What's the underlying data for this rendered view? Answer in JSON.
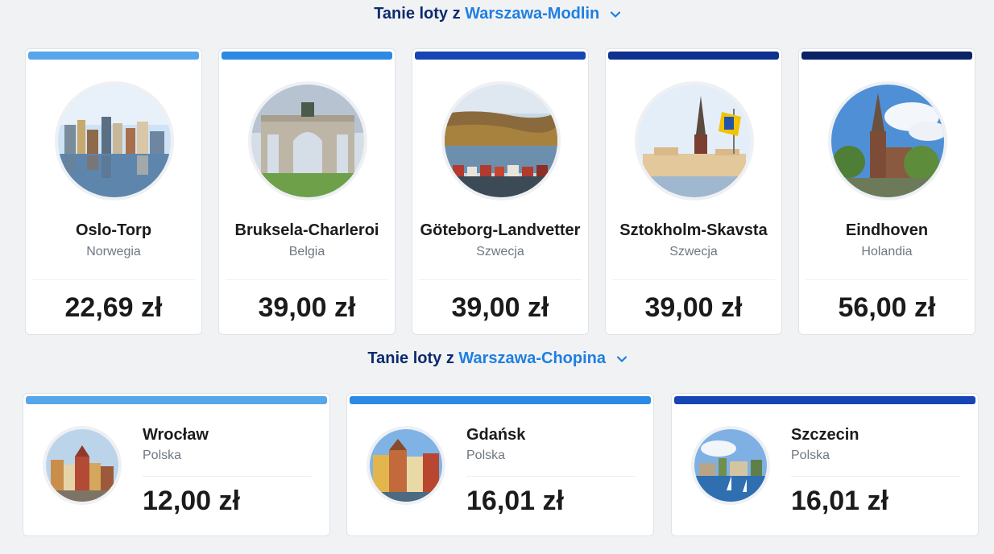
{
  "sections": [
    {
      "prefix": "Tanie loty z ",
      "origin": "Warszawa-Modlin"
    },
    {
      "prefix": "Tanie loty z ",
      "origin": "Warszawa-Chopina"
    }
  ],
  "modlin_destinations": [
    {
      "name": "Oslo-Torp",
      "country": "Norwegia",
      "price": "22,69 zł",
      "bar_color": "#58a6ea",
      "photo_icon": "oslo-waterfront-skyline-icon"
    },
    {
      "name": "Bruksela-Charleroi",
      "country": "Belgia",
      "price": "39,00 zł",
      "bar_color": "#2b8be4",
      "photo_icon": "brussels-arch-icon"
    },
    {
      "name": "Göteborg-Landvetter",
      "country": "Szwecja",
      "price": "39,00 zł",
      "bar_color": "#1546b4",
      "photo_icon": "gothenburg-coast-icon"
    },
    {
      "name": "Sztokholm-Skavsta",
      "country": "Szwecja",
      "price": "39,00 zł",
      "bar_color": "#0f318f",
      "photo_icon": "stockholm-church-flag-icon"
    },
    {
      "name": "Eindhoven",
      "country": "Holandia",
      "price": "56,00 zł",
      "bar_color": "#0b2466",
      "photo_icon": "eindhoven-church-icon"
    }
  ],
  "chopina_destinations": [
    {
      "name": "Wrocław",
      "country": "Polska",
      "price": "12,00 zł",
      "bar_color": "#58a6ea",
      "photo_icon": "wroclaw-market-square-icon"
    },
    {
      "name": "Gdańsk",
      "country": "Polska",
      "price": "16,01 zł",
      "bar_color": "#2b8be4",
      "photo_icon": "gdansk-townhouses-icon"
    },
    {
      "name": "Szczecin",
      "country": "Polska",
      "price": "16,01 zł",
      "bar_color": "#1546b4",
      "photo_icon": "szczecin-waterfront-icon"
    }
  ]
}
